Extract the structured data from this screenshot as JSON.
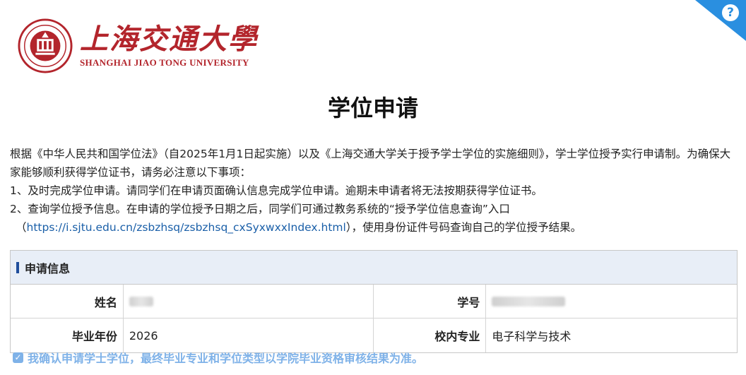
{
  "help": {
    "icon": "question-icon",
    "label": "?"
  },
  "logo": {
    "cn": "上海交通大學",
    "en": "SHANGHAI JIAO TONG UNIVERSITY",
    "color": "#b3252c"
  },
  "title": "学位申请",
  "notice": {
    "p1": "根据《中华人民共和国学位法》（自2025年1月1日起实施）以及《上海交通大学关于授予学士学位的实施细则》，学士学位授予实行申请制。为确保大家能够顺利获得学位证书，请务必注意以下事项：",
    "p2": "1、及时完成学位申请。请同学们在申请页面确认信息完成学位申请。逾期未申请者将无法按期获得学位证书。",
    "p3": "2、查询学位授予信息。在申请的学位授予日期之后，同学们可通过教务系统的“授予学位信息查询”入口",
    "p4_open": "（",
    "p4_link": "https://i.sjtu.edu.cn/zsbzhsq/zsbzhsq_cxSyxwxxIndex.html",
    "p4_rest": "），使用身份证件号码查询自己的学位授予结果。"
  },
  "info": {
    "header": "申请信息",
    "name_label": "姓名",
    "id_label": "学号",
    "year_label": "毕业年份",
    "year_value": "2026",
    "major_label": "校内专业",
    "major_value": "电子科学与技术"
  },
  "confirm": {
    "checked": true,
    "text": "我确认申请学士学位，最终毕业专业和学位类型以学院毕业资格审核结果为准。"
  }
}
